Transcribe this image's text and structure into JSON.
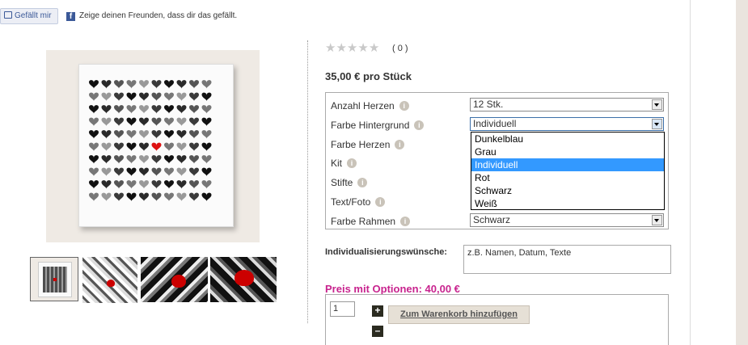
{
  "facebook": {
    "like_label": "Gefällt mir",
    "share_text": "Zeige deinen Freunden, dass dir das gefällt."
  },
  "rating": {
    "stars": 5,
    "filled": 0,
    "count": "( 0 )"
  },
  "price": "35,00 € pro Stück",
  "options": [
    {
      "label": "Anzahl Herzen",
      "value": "12 Stk."
    },
    {
      "label": "Farbe Hintergrund",
      "value": "Individuell"
    },
    {
      "label": "Farbe Herzen",
      "value": ""
    },
    {
      "label": "Kit",
      "value": ""
    },
    {
      "label": "Stifte",
      "value": ""
    },
    {
      "label": "Text/Foto",
      "value": ""
    },
    {
      "label": "Farbe Rahmen",
      "value": "Schwarz"
    }
  ],
  "dropdown": {
    "items": [
      "Dunkelblau",
      "Grau",
      "Individuell",
      "Rot",
      "Schwarz",
      "Weiß"
    ],
    "selected_index": 2
  },
  "individual": {
    "label": "Individualisierungswünsche:",
    "value": "z.B. Namen, Datum, Texte"
  },
  "price_with_options": "Preis mit Optionen: 40,00 €",
  "cart": {
    "quantity": "1",
    "plus": "+",
    "minus": "–",
    "button_label": "Zum Warenkorb hinzufügen"
  },
  "colors": {
    "accent_price": "#c8238e",
    "dropdown_selected": "#3399ff",
    "facebook": "#3b5998"
  },
  "thumbnails": [
    "thumbnail-1",
    "thumbnail-2",
    "thumbnail-3",
    "thumbnail-4"
  ]
}
